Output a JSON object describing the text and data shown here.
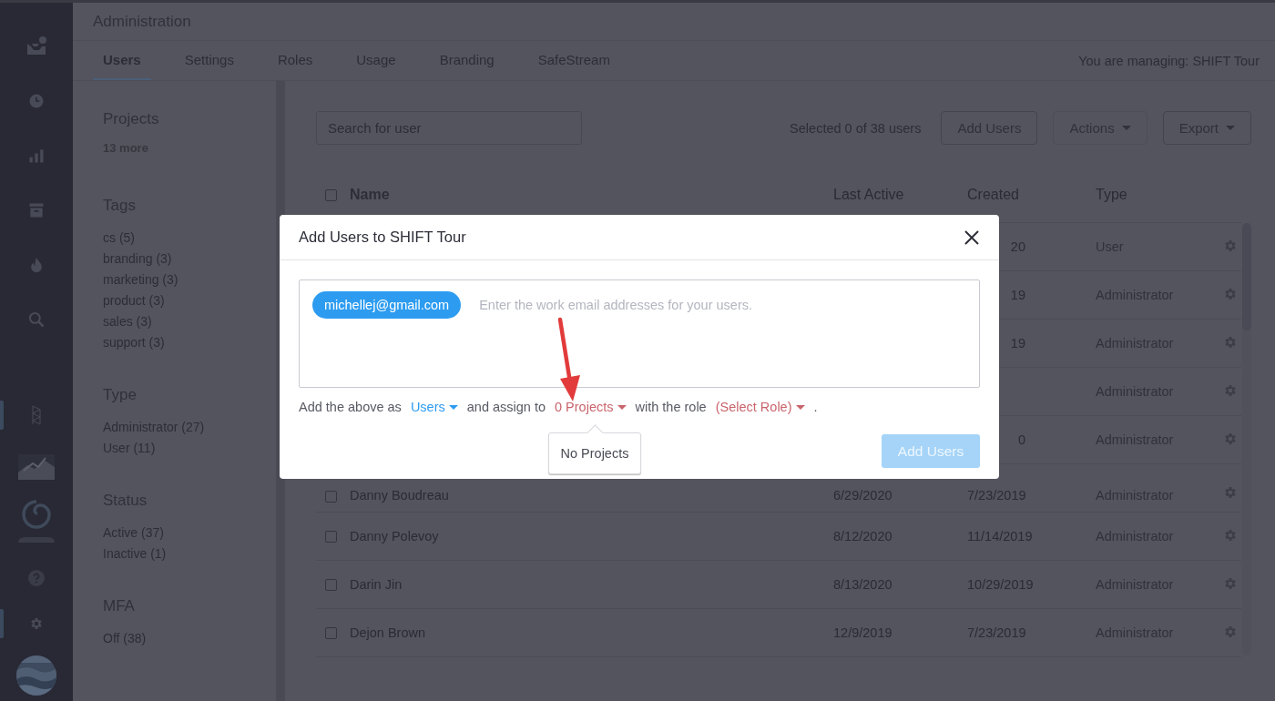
{
  "page": {
    "title": "Administration"
  },
  "tabs": [
    {
      "label": "Users",
      "selected": true
    },
    {
      "label": "Settings",
      "selected": false
    },
    {
      "label": "Roles",
      "selected": false
    },
    {
      "label": "Usage",
      "selected": false
    },
    {
      "label": "Branding",
      "selected": false
    },
    {
      "label": "SafeStream",
      "selected": false
    }
  ],
  "managing": "You are managing: SHIFT Tour",
  "filters": [
    {
      "title": "Projects",
      "more": "13 more"
    },
    {
      "title": "Tags",
      "items": [
        "cs (5)",
        "branding (3)",
        "marketing (3)",
        "product (3)",
        "sales (3)",
        "support (3)"
      ]
    },
    {
      "title": "Type",
      "items": [
        "Administrator (27)",
        "User (11)"
      ]
    },
    {
      "title": "Status",
      "items": [
        "Active (37)",
        "Inactive (1)"
      ]
    },
    {
      "title": "MFA",
      "items": [
        "Off (38)"
      ]
    }
  ],
  "search": {
    "placeholder": "Search for user"
  },
  "selection_count": "Selected 0 of 38 users",
  "toolbar": [
    {
      "label": "Add Users",
      "disabled": false,
      "menu": false
    },
    {
      "label": "Actions",
      "disabled": true,
      "menu": true
    },
    {
      "label": "Export",
      "disabled": false,
      "menu": true
    }
  ],
  "table": {
    "select_all_checked": false,
    "columns": [
      "Name",
      "Last Active",
      "Created",
      "Type"
    ],
    "rows": [
      {
        "created": "20",
        "type": "User"
      },
      {
        "created": "19",
        "type": "Administrator"
      },
      {
        "created": "19",
        "type": "Administrator"
      },
      {
        "type": "Administrator"
      },
      {
        "created": "0",
        "type": "Administrator"
      },
      {
        "name": "Danny Boudreau",
        "checked": false,
        "last_active": "6/29/2020",
        "created": "7/23/2019",
        "type": "Administrator"
      },
      {
        "name": "Danny Polevoy",
        "checked": false,
        "last_active": "8/12/2020",
        "created": "11/14/2019",
        "type": "Administrator"
      },
      {
        "name": "Darin Jin",
        "checked": false,
        "last_active": "8/13/2020",
        "created": "10/29/2019",
        "type": "Administrator"
      },
      {
        "name": "Dejon Brown",
        "checked": false,
        "last_active": "12/9/2019",
        "created": "7/23/2019",
        "type": "Administrator"
      }
    ]
  },
  "modal": {
    "title": "Add Users to SHIFT Tour",
    "emails": [
      "michellej@gmail.com"
    ],
    "placeholder": "Enter the work email addresses for your users.",
    "assign_line": [
      {
        "kind": "text",
        "text": "Add the above as"
      },
      {
        "kind": "dropdown",
        "text": "Users",
        "color": "#2d9cf0"
      },
      {
        "kind": "text",
        "text": "and assign to"
      },
      {
        "kind": "dropdown",
        "text": "0 Projects",
        "color": "#c9646c"
      },
      {
        "kind": "text",
        "text": "with the role"
      },
      {
        "kind": "dropdown",
        "text": "(Select Role)",
        "color": "#c9646c"
      },
      {
        "kind": "text",
        "text": "."
      }
    ],
    "popover": "No Projects",
    "submit": {
      "label": "Add Users",
      "disabled": true
    }
  }
}
